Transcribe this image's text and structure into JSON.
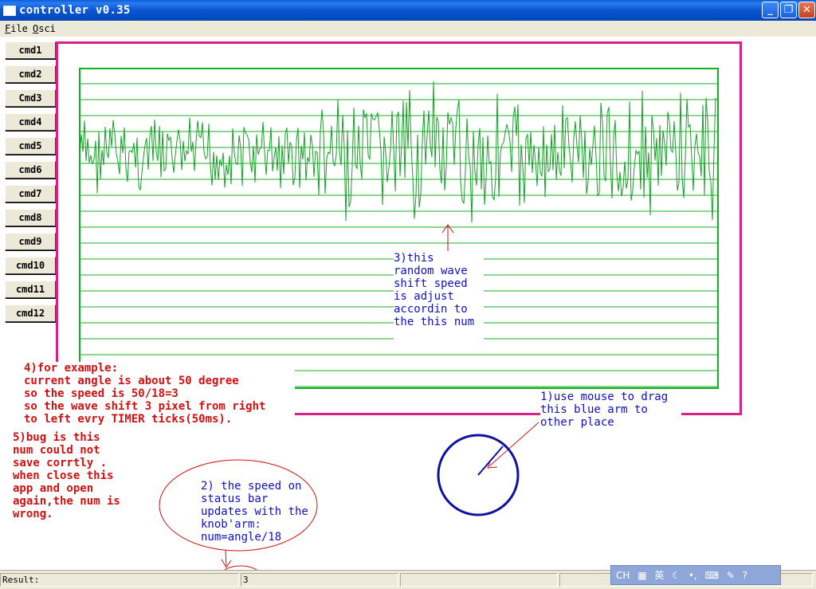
{
  "window": {
    "title": "controller v0.35"
  },
  "menu": {
    "items": [
      "File",
      "Osci"
    ]
  },
  "sidebar": {
    "buttons": [
      "cmd1",
      "cmd2",
      "Cmd3",
      "cmd4",
      "cmd5",
      "cmd6",
      "cmd7",
      "cmd8",
      "cmd9",
      "cmd10",
      "cmd11",
      "cmd12"
    ]
  },
  "annotations": {
    "note1": "1)use mouse to drag\nthis blue arm to\nother place",
    "note2": "2) the speed on\nstatus bar\nupdates with the\nknob'arm:\nnum=angle/18",
    "note3": "3)this\nrandom wave\nshift speed\nis adjust\naccordin to\nthe this num",
    "note4": "4)for example:\ncurrent angle is about 50 degree\nso the speed is 50/18=3\nso the wave shift 3 pixel from right\nto left evry TIMER ticks(50ms).",
    "note5": "5)bug is this\nnum could not\nsave corrtly .\nwhen close this\napp and open\nagain,the num is\nwrong."
  },
  "statusbar": {
    "label": "Result:",
    "value": "3"
  },
  "tray": {
    "items": [
      "CH",
      "英"
    ]
  },
  "colors": {
    "frame": "#d6208a",
    "scope": "#10b020",
    "knob": "#1010a0",
    "annotation_red": "#d01010"
  }
}
